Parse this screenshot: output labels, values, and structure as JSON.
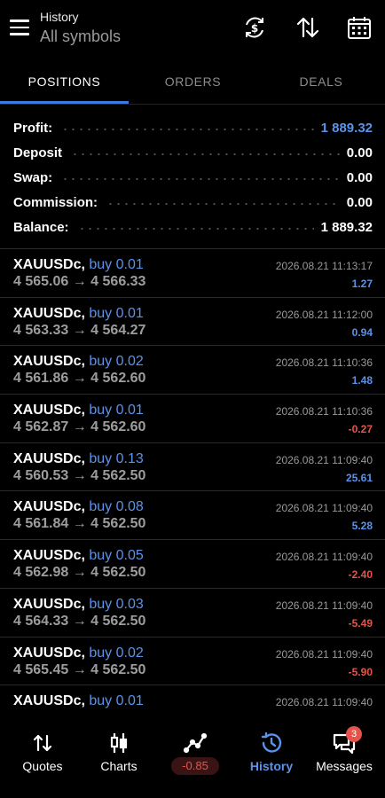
{
  "header": {
    "title": "History",
    "subtitle": "All symbols"
  },
  "tabs": [
    {
      "label": "POSITIONS",
      "active": true
    },
    {
      "label": "ORDERS",
      "active": false
    },
    {
      "label": "DEALS",
      "active": false
    }
  ],
  "summary": [
    {
      "label": "Profit:",
      "value": "1 889.32",
      "highlight": true
    },
    {
      "label": "Deposit",
      "value": "0.00",
      "highlight": false
    },
    {
      "label": "Swap:",
      "value": "0.00",
      "highlight": false
    },
    {
      "label": "Commission:",
      "value": "0.00",
      "highlight": false
    },
    {
      "label": "Balance:",
      "value": "1 889.32",
      "highlight": false
    }
  ],
  "deals": [
    {
      "symbol": "XAUUSDc,",
      "side": "buy 0.01",
      "prices": "4 565.06 → 4 566.33",
      "time": "2026.08.21 11:13:17",
      "pl": "1.27",
      "sign": "pos"
    },
    {
      "symbol": "XAUUSDc,",
      "side": "buy 0.01",
      "prices": "4 563.33 → 4 564.27",
      "time": "2026.08.21 11:12:00",
      "pl": "0.94",
      "sign": "pos"
    },
    {
      "symbol": "XAUUSDc,",
      "side": "buy 0.02",
      "prices": "4 561.86 → 4 562.60",
      "time": "2026.08.21 11:10:36",
      "pl": "1.48",
      "sign": "pos"
    },
    {
      "symbol": "XAUUSDc,",
      "side": "buy 0.01",
      "prices": "4 562.87 → 4 562.60",
      "time": "2026.08.21 11:10:36",
      "pl": "-0.27",
      "sign": "neg"
    },
    {
      "symbol": "XAUUSDc,",
      "side": "buy 0.13",
      "prices": "4 560.53 → 4 562.50",
      "time": "2026.08.21 11:09:40",
      "pl": "25.61",
      "sign": "pos"
    },
    {
      "symbol": "XAUUSDc,",
      "side": "buy 0.08",
      "prices": "4 561.84 → 4 562.50",
      "time": "2026.08.21 11:09:40",
      "pl": "5.28",
      "sign": "pos"
    },
    {
      "symbol": "XAUUSDc,",
      "side": "buy 0.05",
      "prices": "4 562.98 → 4 562.50",
      "time": "2026.08.21 11:09:40",
      "pl": "-2.40",
      "sign": "neg"
    },
    {
      "symbol": "XAUUSDc,",
      "side": "buy 0.03",
      "prices": "4 564.33 → 4 562.50",
      "time": "2026.08.21 11:09:40",
      "pl": "-5.49",
      "sign": "neg"
    },
    {
      "symbol": "XAUUSDc,",
      "side": "buy 0.02",
      "prices": "4 565.45 → 4 562.50",
      "time": "2026.08.21 11:09:40",
      "pl": "-5.90",
      "sign": "neg"
    },
    {
      "symbol": "XAUUSDc,",
      "side": "buy 0.01",
      "prices": "",
      "time": "2026.08.21 11:09:40",
      "pl": "",
      "sign": "pos"
    }
  ],
  "nav": [
    {
      "label": "Quotes",
      "icon": "arrows-up-down-icon",
      "active": false
    },
    {
      "label": "Charts",
      "icon": "candlestick-icon",
      "active": false
    },
    {
      "label": "",
      "icon": "trade-line-icon",
      "active": false,
      "pill": "-0.85"
    },
    {
      "label": "History",
      "icon": "history-clock-icon",
      "active": true
    },
    {
      "label": "Messages",
      "icon": "chat-icon",
      "active": false,
      "badge": "3"
    }
  ],
  "colors": {
    "accent": "#5b92ea",
    "negative": "#e5534b",
    "background": "#000000"
  }
}
